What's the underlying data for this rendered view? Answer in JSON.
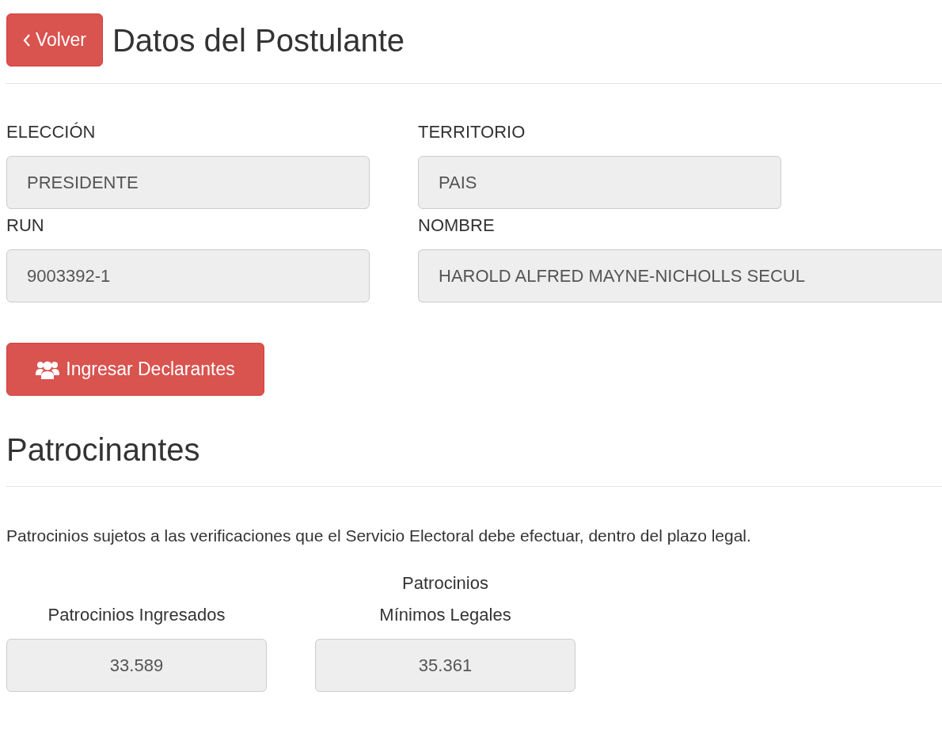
{
  "back_button": {
    "label": "Volver"
  },
  "page_title": "Datos del Postulante",
  "fields": [
    {
      "label": "ELECCIÓN",
      "value": "PRESIDENTE",
      "disabled": true
    },
    {
      "label": "TERRITORIO",
      "value": "PAIS",
      "disabled": true
    },
    {
      "label": "RUN",
      "value": "9003392-1",
      "disabled": true
    },
    {
      "label": "NOMBRE",
      "value": "HAROLD ALFRED MAYNE-NICHOLLS SECUL",
      "disabled": true
    }
  ],
  "declarantes_button": {
    "label": "Ingresar Declarantes"
  },
  "section": {
    "title": "Patrocinantes",
    "description": "Patrocinios sujetos a las verificaciones que el Servicio Electoral debe efectuar, dentro del plazo legal."
  },
  "stats": [
    {
      "label": "Patrocinios Ingresados",
      "value": "33.589",
      "disabled": true
    },
    {
      "label": "Patrocinios Mínimos Legales",
      "value": "35.361",
      "disabled": true
    }
  ]
}
